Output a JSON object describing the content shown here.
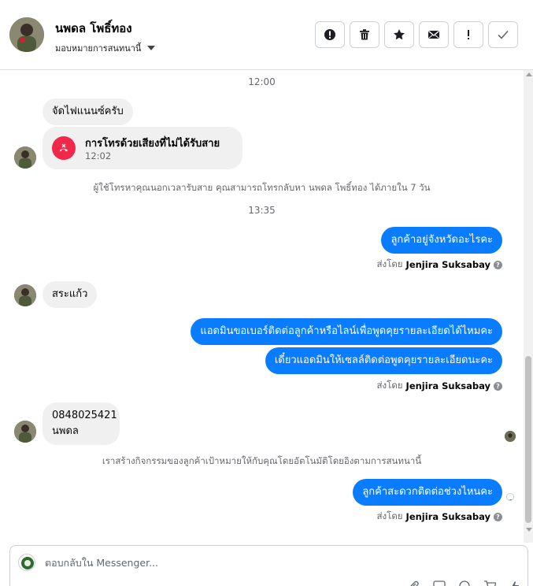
{
  "header": {
    "contact_name": "นพดล โพธิ์ทอง",
    "assign_label": "มอบหมายการสนทนานี้",
    "actions": [
      "mark-spam",
      "delete",
      "star",
      "mark-unread",
      "important",
      "done"
    ]
  },
  "thread": {
    "ts1": "12:00",
    "msg1": "จัดไฟแนนซ์ครับ",
    "call_title": "การโทรด้วยเสียงที่ไม่ได้รับสาย",
    "call_time": "12:02",
    "sys1": "ผู้ใช้โทรหาคุณนอกเวลารับสาย คุณสามารถโทรกลับหา นพดล โพธิ์ทอง ได้ภายใน 7 วัน",
    "ts2": "13:35",
    "out1": "ลูกค้าอยู่จังหวัดอะไรคะ",
    "sent_prefix": "ส่งโดย",
    "sent_name": "Jenjira Suksabay",
    "msg2": "สระแก้ว",
    "out2": "แอดมินขอเบอร์ติดต่อลูกค้าหรือไลน์เพื่อพูดคุยรายละเอียดได้ไหมคะ",
    "out3": "เดี๋ยวแอดมินให้เซลล์ติดต่อพูดคุยรายละเอียดนะคะ",
    "msg3_line1": "0848025421",
    "msg3_line2": "นพดล",
    "sys2": "เราสร้างกิจกรรมของลูกค้าเป้าหมายให้กับคุณโดยอัตโนมัติโดยอิงตามการสนทนานี้",
    "out4": "ลูกค้าสะดวกติดต่อช่วงไหนคะ"
  },
  "composer": {
    "placeholder": "ตอบกลับใน Messenger..."
  },
  "colors": {
    "outgoing": "#0a7cff",
    "incoming": "#f0f0f0",
    "missed_call": "#f02849"
  }
}
